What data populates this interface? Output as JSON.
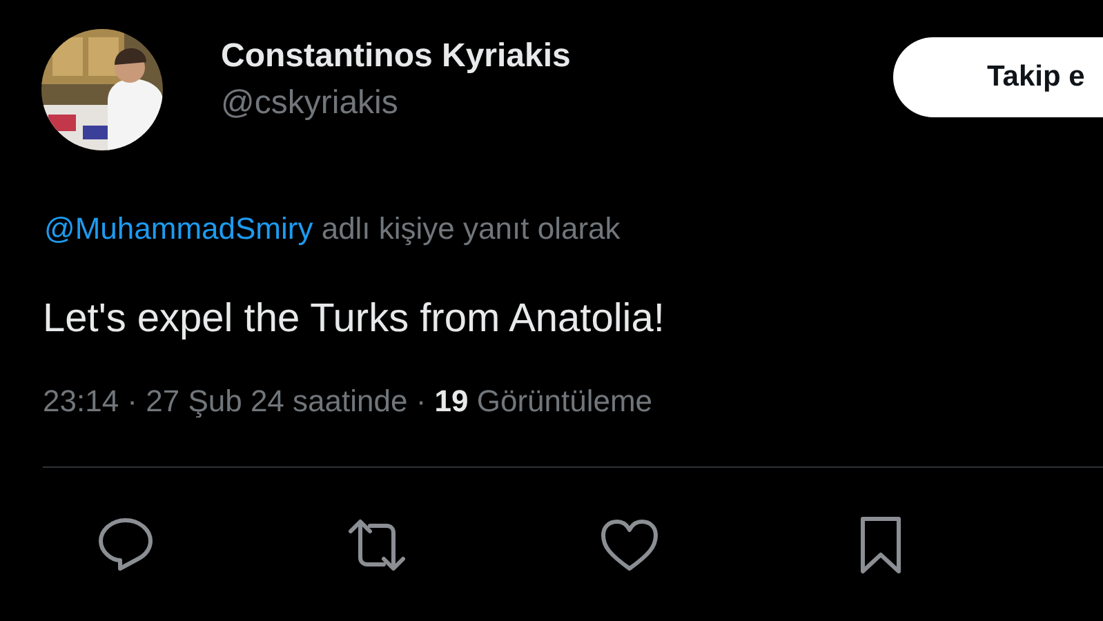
{
  "author": {
    "name": "Constantinos Kyriakis",
    "handle": "@cskyriakis"
  },
  "follow_button": {
    "label": "Takip e"
  },
  "reply_context": {
    "mention": "@MuhammadSmiry",
    "text": "adlı kişiye yanıt olarak"
  },
  "tweet_text": "Let's expel the Turks from Anatolia!",
  "meta": "23:14 · 27 Şub 24 saatinde · **19** Görüntüleme",
  "actions": [
    {
      "kind": "reply"
    },
    {
      "kind": "retweet"
    },
    {
      "kind": "like"
    },
    {
      "kind": "bookmark"
    }
  ]
}
